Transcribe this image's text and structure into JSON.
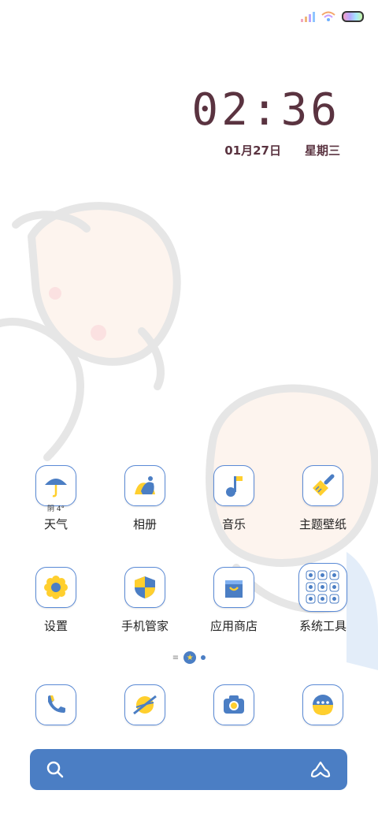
{
  "status_bar": {
    "signal_icon": "signal-bars-icon",
    "wifi_icon": "wifi-icon",
    "battery_icon": "battery-icon"
  },
  "clock": {
    "time": "02:36",
    "date": "01月27日",
    "weekday": "星期三"
  },
  "apps": [
    {
      "label": "天气",
      "sub": "阴 4°",
      "icon": "umbrella-icon"
    },
    {
      "label": "相册",
      "icon": "gallery-icon"
    },
    {
      "label": "音乐",
      "icon": "music-note-icon"
    },
    {
      "label": "主题壁纸",
      "icon": "paintbrush-icon"
    },
    {
      "label": "设置",
      "icon": "gear-icon"
    },
    {
      "label": "手机管家",
      "icon": "shield-icon"
    },
    {
      "label": "应用商店",
      "icon": "shopping-bag-icon"
    },
    {
      "label": "系统工具",
      "icon": "folder-grid-icon"
    }
  ],
  "page_indicator": {
    "current": 2,
    "total": 2
  },
  "dock": [
    {
      "icon": "phone-icon"
    },
    {
      "icon": "browser-icon"
    },
    {
      "icon": "camera-icon"
    },
    {
      "icon": "messages-icon"
    }
  ],
  "search_bar": {
    "search_icon": "search-icon",
    "assistant_icon": "assistant-icon"
  },
  "colors": {
    "accent": "#4b7ec4",
    "yellow": "#ffd83d",
    "clock_text": "#5a3340"
  }
}
